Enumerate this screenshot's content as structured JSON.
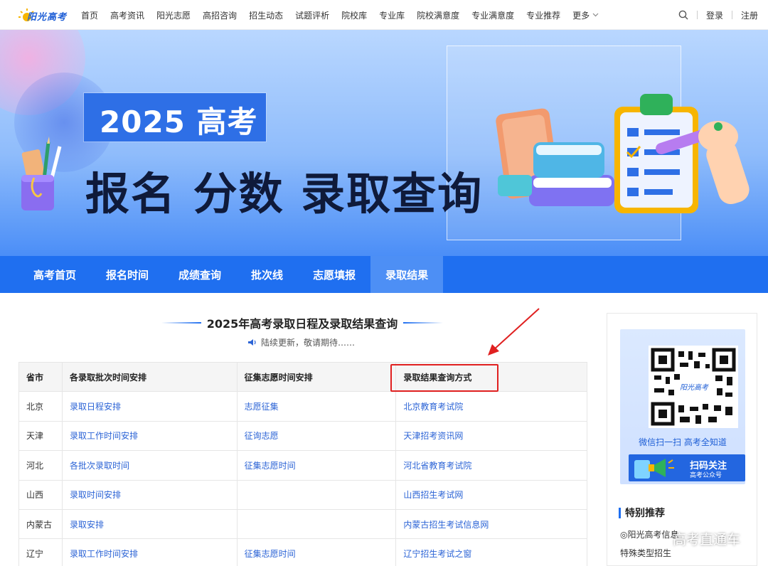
{
  "header": {
    "logo_text": "阳光高考",
    "nav": [
      "首页",
      "高考资讯",
      "阳光志愿",
      "高招咨询",
      "招生动态",
      "试题评析",
      "院校库",
      "专业库",
      "院校满意度",
      "专业满意度",
      "专业推荐"
    ],
    "more_label": "更多",
    "login_label": "登录",
    "register_label": "注册"
  },
  "banner": {
    "tag": "2025 高考",
    "headline": "报名 分数 录取查询"
  },
  "subnav": {
    "items": [
      "高考首页",
      "报名时间",
      "成绩查询",
      "批次线",
      "志愿填报",
      "录取结果"
    ]
  },
  "main": {
    "section_title": "2025年高考录取日程及录取结果查询",
    "notice": "陆续更新，敬请期待……",
    "table": {
      "headers": [
        "省市",
        "各录取批次时间安排",
        "征集志愿时间安排",
        "录取结果查询方式"
      ],
      "rows": [
        [
          "北京",
          "录取日程安排",
          "志愿征集",
          "北京教育考试院"
        ],
        [
          "天津",
          "录取工作时间安排",
          "征询志愿",
          "天津招考资讯网"
        ],
        [
          "河北",
          "各批次录取时间",
          "征集志愿时间",
          "河北省教育考试院"
        ],
        [
          "山西",
          "录取时间安排",
          "",
          "山西招生考试网"
        ],
        [
          "内蒙古",
          "录取安排",
          "",
          "内蒙古招生考试信息网"
        ],
        [
          "辽宁",
          "录取工作时间安排",
          "征集志愿时间",
          "辽宁招生考试之窗"
        ]
      ]
    }
  },
  "sidebar": {
    "qr_caption": "微信扫一扫  高考全知道",
    "scan_title": "扫码关注",
    "scan_subtitle": "高考公众号",
    "special_title": "特别推荐",
    "list": [
      "◎阳光高考信息",
      "特殊类型招生"
    ]
  },
  "watermark": "高考直通车",
  "colors": {
    "brand_blue": "#1f6ff0",
    "link_blue": "#2c64d6",
    "highlight_red": "#e02020"
  }
}
